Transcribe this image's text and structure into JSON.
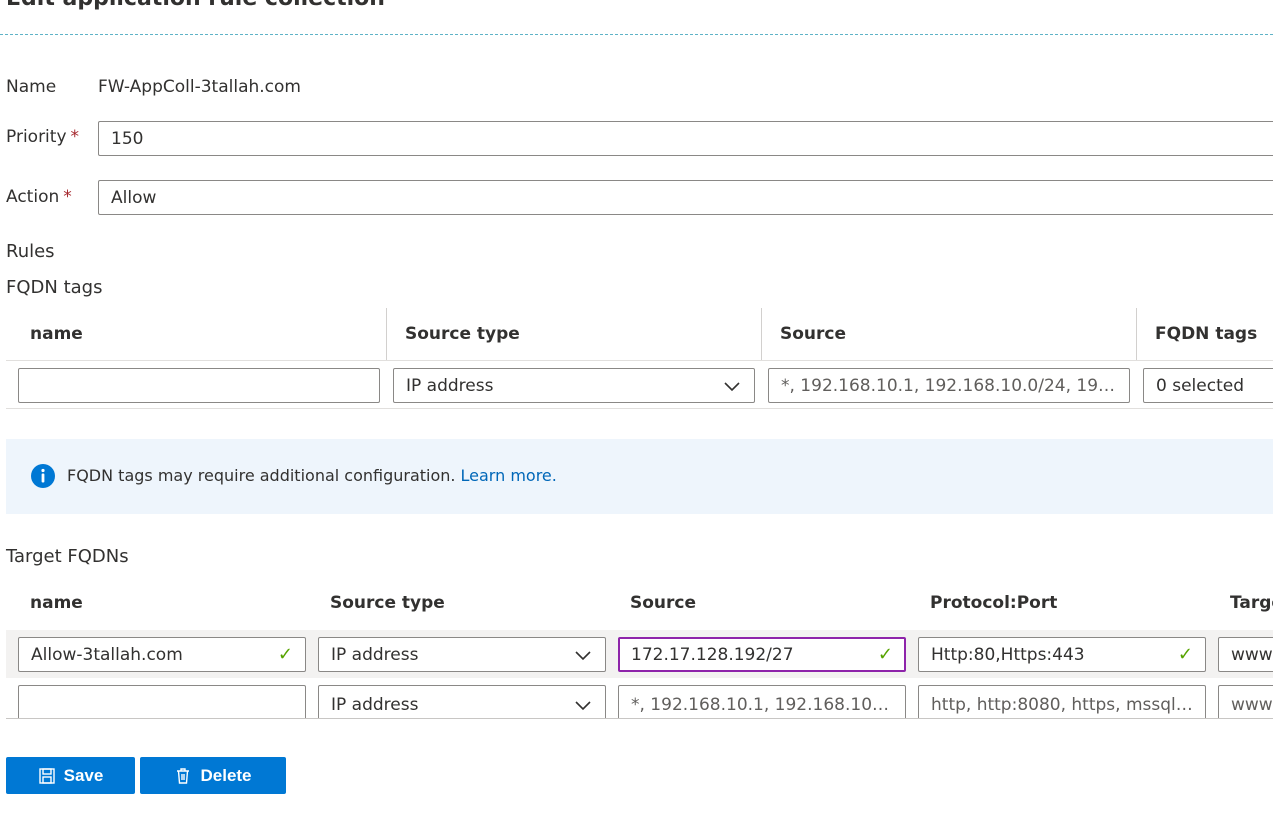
{
  "header": {
    "title": "Edit application rule collection"
  },
  "form": {
    "name_label": "Name",
    "name_value": "FW-AppColl-3tallah.com",
    "priority_label": "Priority",
    "priority_value": "150",
    "action_label": "Action",
    "action_value": "Allow",
    "required_marker": "*"
  },
  "rules": {
    "label": "Rules"
  },
  "fqdn_tags": {
    "label": "FQDN tags",
    "columns": [
      "name",
      "Source type",
      "Source",
      "FQDN tags"
    ],
    "row": {
      "name_value": "",
      "source_type": "IP address",
      "source_placeholder": "*, 192.168.10.1, 192.168.10.0/24, 192....",
      "tags_value": "0 selected"
    }
  },
  "info": {
    "text": "FQDN tags may require additional configuration.",
    "link": "Learn more."
  },
  "target_fqdns": {
    "label": "Target FQDNs",
    "columns": [
      "name",
      "Source type",
      "Source",
      "Protocol:Port",
      "Targe"
    ],
    "rows": [
      {
        "name": "Allow-3tallah.com",
        "source_type": "IP address",
        "source": "172.17.128.192/27",
        "protocol_port": "Http:80,Https:443",
        "target": "www"
      },
      {
        "name": "",
        "source_type": "IP address",
        "source_placeholder": "*, 192.168.10.1, 192.168.10.0...",
        "protocol_port_placeholder": "http, http:8080, https, mssql:...",
        "target_placeholder": "www"
      }
    ]
  },
  "actions": {
    "save_label": "Save",
    "delete_label": "Delete"
  },
  "colors": {
    "accent": "#0078d4",
    "focus_border": "#8e24aa",
    "valid_check": "#57a300",
    "required": "#a4262c",
    "link": "#0067b8",
    "info_background": "#eef5fc"
  }
}
